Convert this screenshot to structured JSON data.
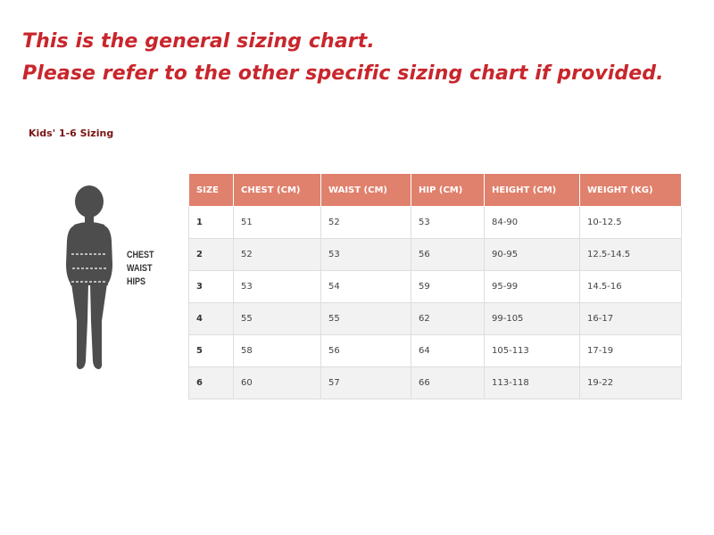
{
  "headline": {
    "line1": "This is the general sizing chart.",
    "line2": "Please refer to the other specific sizing chart if provided."
  },
  "section_title": "Kids' 1-6 Sizing",
  "figure": {
    "labels": [
      "CHEST",
      "WAIST",
      "HIPS"
    ]
  },
  "table": {
    "columns": [
      "SIZE",
      "CHEST (CM)",
      "WAIST (CM)",
      "HIP (CM)",
      "HEIGHT (CM)",
      "WEIGHT (KG)"
    ],
    "rows": [
      [
        "1",
        "51",
        "52",
        "53",
        "84-90",
        "10-12.5"
      ],
      [
        "2",
        "52",
        "53",
        "56",
        "90-95",
        "12.5-14.5"
      ],
      [
        "3",
        "53",
        "54",
        "59",
        "95-99",
        "14.5-16"
      ],
      [
        "4",
        "55",
        "55",
        "62",
        "99-105",
        "16-17"
      ],
      [
        "5",
        "58",
        "56",
        "64",
        "105-113",
        "17-19"
      ],
      [
        "6",
        "60",
        "57",
        "66",
        "113-118",
        "19-22"
      ]
    ]
  },
  "colors": {
    "headline": "#c8262c",
    "section_title": "#7a1515",
    "table_header_bg": "#e0816d",
    "table_header_text": "#ffffff",
    "row_alt_bg": "#f2f2f2",
    "silhouette": "#4d4d4d"
  }
}
